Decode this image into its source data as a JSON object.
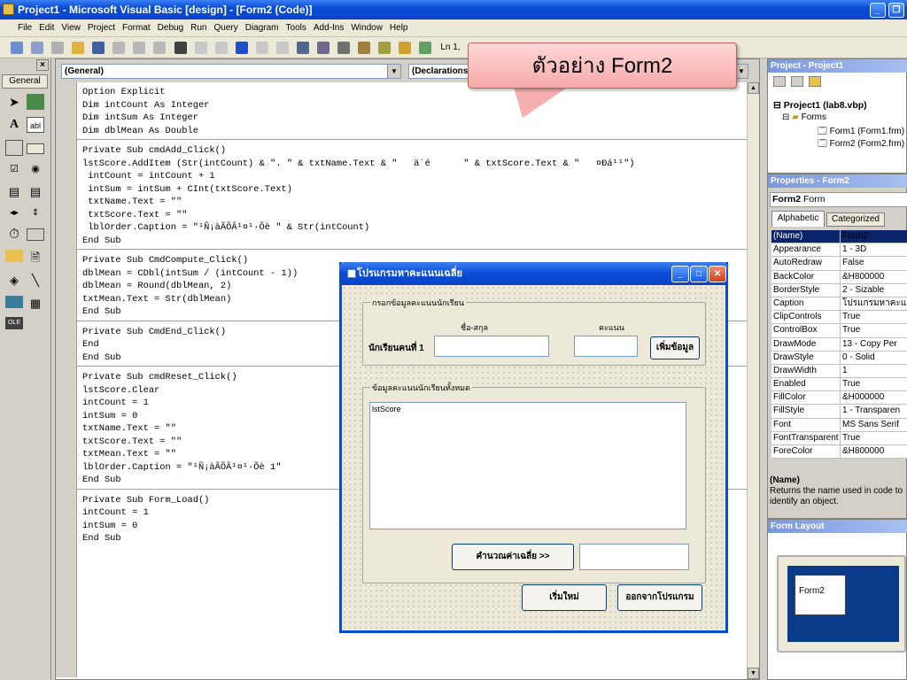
{
  "window": {
    "title": "Project1 - Microsoft Visual Basic [design] - [Form2 (Code)]"
  },
  "menu": [
    "File",
    "Edit",
    "View",
    "Project",
    "Format",
    "Debug",
    "Run",
    "Query",
    "Diagram",
    "Tools",
    "Add-Ins",
    "Window",
    "Help"
  ],
  "toolbar": {
    "position": "Ln 1,"
  },
  "toolbox": {
    "title": "General"
  },
  "code_window": {
    "object_combo": "(General)",
    "proc_combo": "(Declarations)",
    "lines": [
      "Option Explicit",
      "Dim intCount As Integer",
      "Dim intSum As Integer",
      "Dim dblMean As Double",
      "",
      "Private Sub cmdAdd_Click()",
      "lstScore.AddItem (Str(intCount) & \". \" & txtName.Text & \"   ä´é      \" & txtScore.Text & \"   ¤Ðá¹¹\")",
      " intCount = intCount + 1",
      " intSum = intSum + CInt(txtScore.Text)",
      " txtName.Text = \"\"",
      " txtScore.Text = \"\"",
      " lblOrder.Caption = \"¹Ñ¡àÃÕÂ¹¤¹·Õè \" & Str(intCount)",
      "End Sub",
      "",
      "Private Sub CmdCompute_Click()",
      "dblMean = CDbl(intSum / (intCount - 1))",
      "dblMean = Round(dblMean, 2)",
      "txtMean.Text = Str(dblMean)",
      "End Sub",
      "",
      "Private Sub CmdEnd_Click()",
      "End",
      "End Sub",
      "",
      "Private Sub cmdReset_Click()",
      "lstScore.Clear",
      "intCount = 1",
      "intSum = 0",
      "txtName.Text = \"\"",
      "txtScore.Text = \"\"",
      "txtMean.Text = \"\"",
      "lblOrder.Caption = \"¹Ñ¡àÃÕÂ¹¤¹·Õè 1\"",
      "End Sub",
      "",
      "Private Sub Form_Load()",
      "intCount = 1",
      "intSum = 0",
      "End Sub"
    ]
  },
  "callout": {
    "text": "ตัวอย่าง Form2"
  },
  "form2": {
    "title": "โปรแกรมหาคะแนนเฉลี่ย",
    "frame1_label": "กรอกข้อมูลคะแนนนักเรียน",
    "name_header": "ชื่อ-สกุล",
    "score_header": "คะแนน",
    "order_label": "นักเรียนคนที่ 1",
    "add_button": "เพิ่มข้อมูล",
    "frame2_label": "ข้อมูลคะแนนนักเรียนทั้งหมด",
    "list_name": "lstScore",
    "compute_button": "คำนวณค่าเฉลี่ย >>",
    "reset_button": "เริ่มใหม่",
    "exit_button": "ออกจากโปรแกรม"
  },
  "project_pane": {
    "title": "Project - Project1",
    "project": "Project1 (lab8.vbp)",
    "folder": "Forms",
    "items": [
      "Form1 (Form1.frm)",
      "Form2 (Form2.frm)"
    ]
  },
  "properties_pane": {
    "title": "Properties - Form2",
    "object": "Form2",
    "object_type": "Form",
    "tab_alpha": "Alphabetic",
    "tab_cat": "Categorized",
    "rows": [
      {
        "name": "(Name)",
        "value": "Form2"
      },
      {
        "name": "Appearance",
        "value": "1 - 3D"
      },
      {
        "name": "AutoRedraw",
        "value": "False"
      },
      {
        "name": "BackColor",
        "value": "&H800000"
      },
      {
        "name": "BorderStyle",
        "value": "2 - Sizable"
      },
      {
        "name": "Caption",
        "value": "โปรแกรมหาคะแ"
      },
      {
        "name": "ClipControls",
        "value": "True"
      },
      {
        "name": "ControlBox",
        "value": "True"
      },
      {
        "name": "DrawMode",
        "value": "13 - Copy Per"
      },
      {
        "name": "DrawStyle",
        "value": "0 - Solid"
      },
      {
        "name": "DrawWidth",
        "value": "1"
      },
      {
        "name": "Enabled",
        "value": "True"
      },
      {
        "name": "FillColor",
        "value": "&H000000"
      },
      {
        "name": "FillStyle",
        "value": "1 - Transparen"
      },
      {
        "name": "Font",
        "value": "MS Sans Serif"
      },
      {
        "name": "FontTransparent",
        "value": "True"
      },
      {
        "name": "ForeColor",
        "value": "&H800000"
      }
    ],
    "desc_title": "(Name)",
    "desc_text": "Returns the name used in code to identify an object."
  },
  "layout_pane": {
    "title": "Form Layout",
    "form_label": "Form2"
  }
}
